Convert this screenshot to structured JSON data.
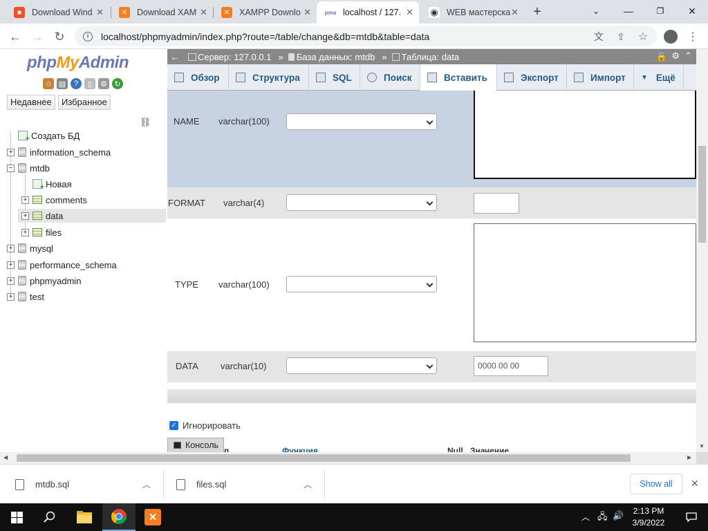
{
  "browser": {
    "tabs": [
      {
        "title": "Download Wind",
        "favicon": "windows-icon",
        "color": "#f25022"
      },
      {
        "title": "Download XAM",
        "favicon": "xampp-icon",
        "color": "#f57e20"
      },
      {
        "title": "XAMPP Downlo",
        "favicon": "xampp-icon",
        "color": "#f57e20"
      },
      {
        "title": "localhost / 127.",
        "favicon": "phpmyadmin-icon",
        "color": "#6c78af"
      },
      {
        "title": "WEB мастерска",
        "favicon": "eye-icon",
        "color": "#333333"
      }
    ],
    "new_tab": "+",
    "url": "localhost/phpmyadmin/index.php?route=/table/change&db=mtdb&table=data"
  },
  "sidebar": {
    "logo_php": "php",
    "logo_my": "My",
    "logo_admin": "Admin",
    "buttons": [
      "Недавнее",
      "Избранное"
    ],
    "tree": {
      "create_db": "Создать БД",
      "information_schema": "information_schema",
      "mtdb": "mtdb",
      "new": "Новая",
      "comments": "comments",
      "data": "data",
      "files": "files",
      "mysql": "mysql",
      "performance_schema": "performance_schema",
      "phpmyadmin": "phpmyadmin",
      "test": "test"
    }
  },
  "breadcrumb": {
    "arrow": "←",
    "server": "Сервер: 127.0.0.1",
    "database": "База данных: mtdb",
    "table": "Таблица: data",
    "sep": "»"
  },
  "main_tabs": [
    "Обзор",
    "Структура",
    "SQL",
    "Поиск",
    "Вставить",
    "Экспорт",
    "Импорт",
    "Ещё"
  ],
  "form": {
    "rows": [
      {
        "name": "NAME",
        "type": "varchar(100)"
      },
      {
        "name": "FORMAT",
        "type": "varchar(4)"
      },
      {
        "name": "TYPE",
        "type": "varchar(100)"
      },
      {
        "name": "DATA",
        "type": "varchar(10)",
        "value": "0000 00 00"
      }
    ],
    "ignore_label": "Игнорировать",
    "console_label": "Консоль",
    "col_headers": {
      "function": "Функция",
      "null": "Null",
      "value": "Значение",
      "field_partial": "п"
    }
  },
  "downloads": {
    "items": [
      "mtdb.sql",
      "files.sql"
    ],
    "show_all": "Show all"
  },
  "taskbar": {
    "time": "2:13 PM",
    "date": "3/9/2022"
  }
}
